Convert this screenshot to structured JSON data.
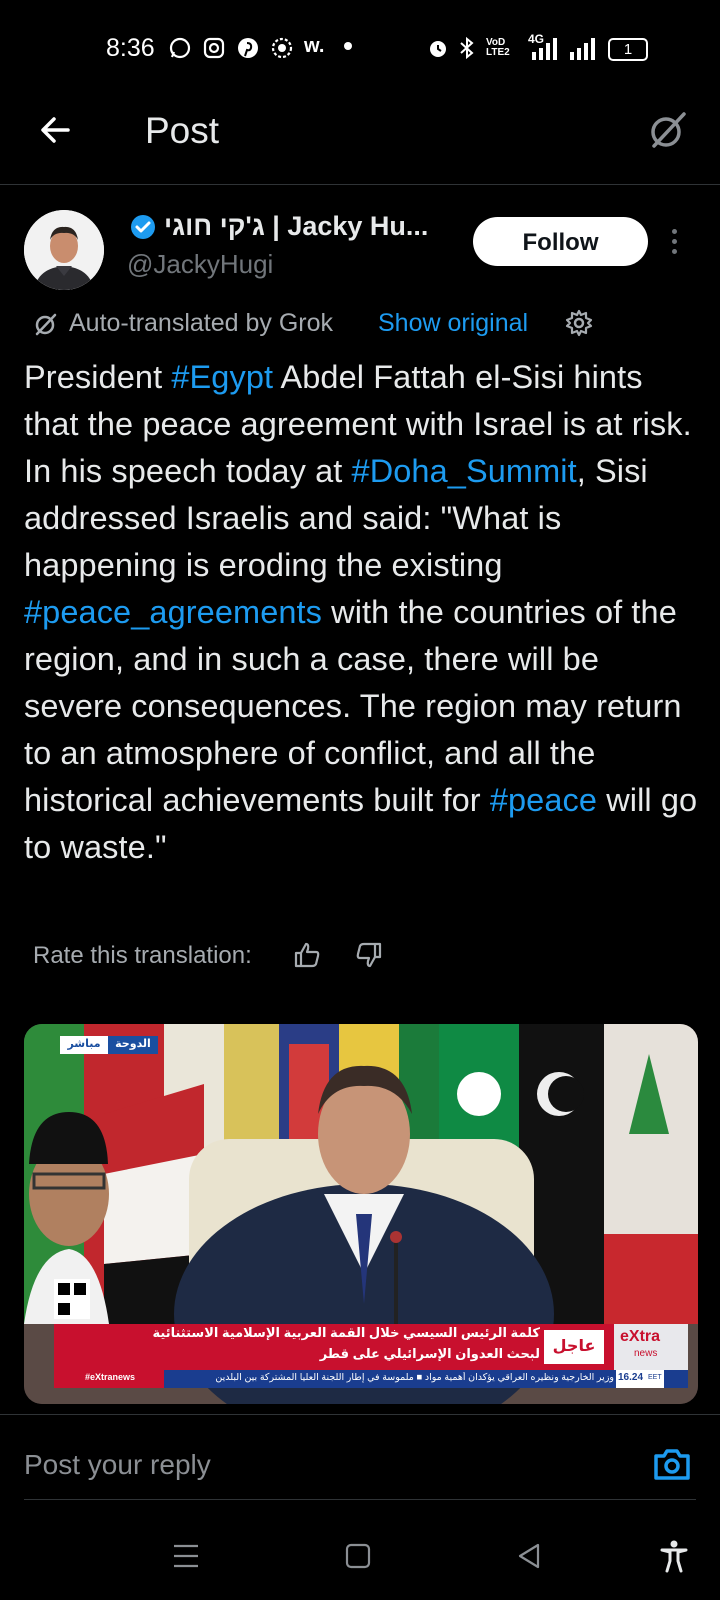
{
  "status_bar": {
    "time": "8:36",
    "network": "4G",
    "battery": "1"
  },
  "header": {
    "title": "Post"
  },
  "author": {
    "name": "ג'קי חוגי | Jacky Hu...",
    "handle": "@JackyHugi",
    "follow_label": "Follow"
  },
  "translation": {
    "label": "Auto-translated by Grok",
    "show_original": "Show original"
  },
  "post": {
    "segments": [
      {
        "text": " President ",
        "tag": false
      },
      {
        "text": "#Egypt",
        "tag": true
      },
      {
        "text": " Abdel Fattah el-Sisi hints that the peace agreement with Israel is at risk. In his speech today at ",
        "tag": false
      },
      {
        "text": "#Doha_Summit",
        "tag": true
      },
      {
        "text": ", Sisi addressed Israelis and said: \"What is happening is eroding the existing ",
        "tag": false
      },
      {
        "text": "#peace_agreements",
        "tag": true
      },
      {
        "text": " with the countries of the region, and in such a case, there will be severe consequences. The region may return to an atmosphere of conflict, and all the historical achievements built for ",
        "tag": false
      },
      {
        "text": "#peace",
        "tag": true
      },
      {
        "text": " will go to waste.\"",
        "tag": false
      }
    ]
  },
  "rate": {
    "label": "Rate this translation:"
  },
  "media": {
    "live_location": "الدوحة",
    "live_label": "مباشر",
    "headline_line1": "كلمة الرئيس السيسي خلال القمة العربية الإسلامية الاستثنائية",
    "headline_line2": "لبحث العدوان الإسرائيلي على قطر",
    "breaking": "عاجل",
    "channel": "eXtra",
    "channel_sub": "news",
    "hashtag": "#eXtranews",
    "ticker": "وزير الخارجية ونظيره العراقي يؤكدان أهمية مواد ■ ملموسة في إطار اللجنة العليا المشتركة بين البلدين",
    "clock": "16.24",
    "clock_zone": "EET"
  },
  "reply": {
    "placeholder": "Post your reply"
  },
  "colors": {
    "accent": "#1d9bf0",
    "background": "#000000",
    "text": "#e7e9ea",
    "muted": "#71767b"
  },
  "icons": [
    "back-arrow-icon",
    "grok-icon",
    "verified-badge-icon",
    "more-icon",
    "gear-icon",
    "thumbs-up-icon",
    "thumbs-down-icon",
    "camera-icon",
    "menu-icon",
    "home-square-icon",
    "back-triangle-icon",
    "accessibility-icon"
  ]
}
